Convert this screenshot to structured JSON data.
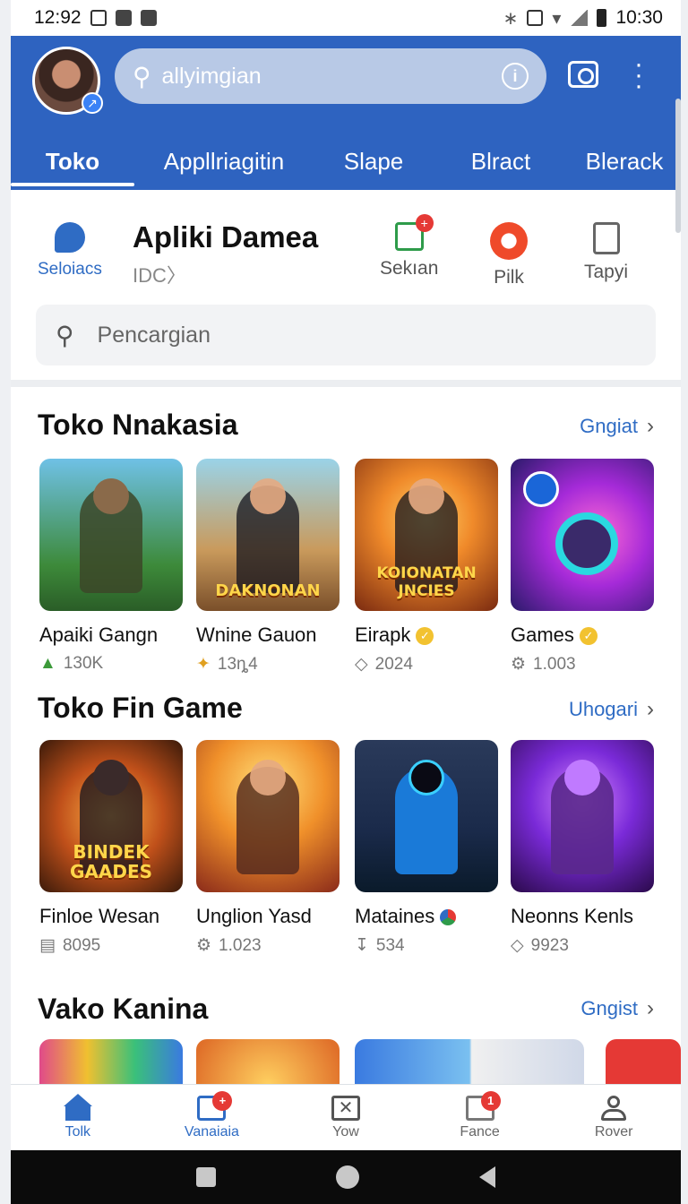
{
  "status_bar": {
    "time_left": "12:92",
    "time_right": "10:30"
  },
  "header": {
    "search_value": "allyimgian",
    "tabs": [
      "Toko",
      "Appllriagitin",
      "Slape",
      "Blract",
      "Blerack"
    ]
  },
  "quick": {
    "left_item": "Seloiacs",
    "title": "Apliki Damea",
    "subtitle": "IDC〉",
    "items": [
      "Sekıan",
      "Pilk",
      "Tapyi"
    ],
    "filter_placeholder": "Pencargian"
  },
  "sections": [
    {
      "title": "Toko Nnakasia",
      "link": "Gngiat",
      "cards": [
        {
          "name": "Apaiki Gangn",
          "stat": "130K",
          "banner": ""
        },
        {
          "name": "Wnine Gauon",
          "stat": "13ȵ4",
          "banner": "DAKNONAN"
        },
        {
          "name": "Eirapk",
          "stat": "2024",
          "banner": "KOIONATAN JNCIES"
        },
        {
          "name": "Games",
          "stat": "1.003",
          "banner": ""
        }
      ]
    },
    {
      "title": "Toko Fin Game",
      "link": "Uhogari",
      "cards": [
        {
          "name": "Finloe Wesan",
          "stat": "8095",
          "banner": "BINDEK GAADES"
        },
        {
          "name": "Unglion Yasd",
          "stat": "1.023",
          "banner": ""
        },
        {
          "name": "Mataines",
          "stat": "534",
          "banner": ""
        },
        {
          "name": "Neonns Kenls",
          "stat": "9923",
          "banner": ""
        }
      ]
    },
    {
      "title": "Vako Kanina",
      "link": "Gngist"
    }
  ],
  "bottom_nav": [
    {
      "label": "Tolk",
      "badge": ""
    },
    {
      "label": "Vanaiaia",
      "badge": "+"
    },
    {
      "label": "Yow",
      "badge": ""
    },
    {
      "label": "Fance",
      "badge": "1"
    },
    {
      "label": "Rover",
      "badge": ""
    }
  ],
  "colors": {
    "header_blue": "#2e63c0",
    "link_blue": "#2f6cc4",
    "badge_red": "#e53935",
    "verify_gold": "#f2c230"
  },
  "icons": [
    "search-icon",
    "info-icon",
    "camera-icon",
    "more-icon",
    "cube-icon",
    "checklist-icon",
    "pill-icon",
    "document-icon",
    "home-icon",
    "chat-icon",
    "box-icon",
    "monitor-icon",
    "person-icon"
  ]
}
